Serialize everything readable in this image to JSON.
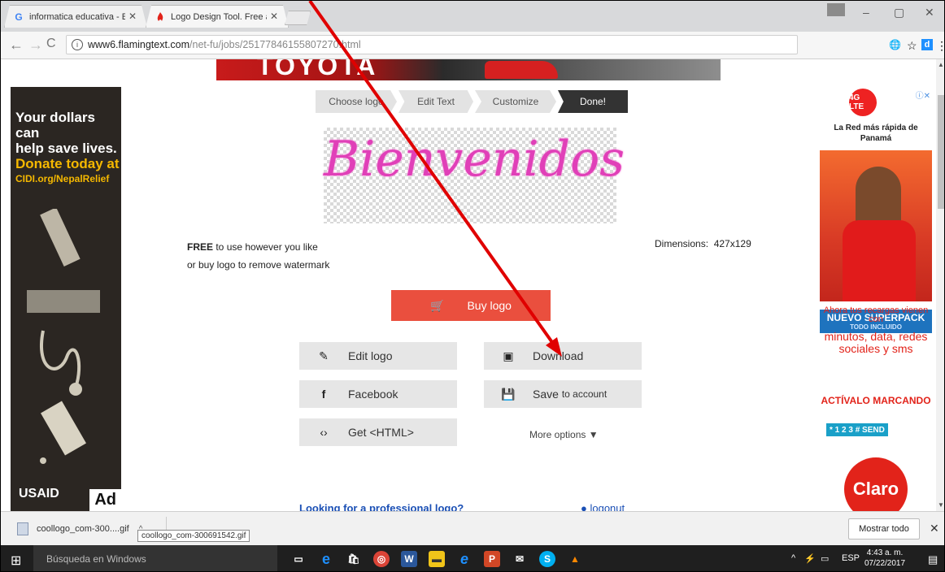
{
  "browser": {
    "tabs": [
      {
        "title": "informatica educativa - E",
        "favicon": "G",
        "favicon_color": "#4285f4"
      },
      {
        "title": "Logo Design Tool. Free a",
        "favicon": "flame-icon",
        "favicon_color": "#e2231a"
      }
    ],
    "url_host": "www6.flamingtext.com",
    "url_path": "/net-fu/jobs/25177846155807270.html",
    "window_controls": {
      "minimize": "–",
      "restore": "▢",
      "close": "✕"
    }
  },
  "page": {
    "banner_text": "TOYOTA",
    "steps": [
      "Choose logo",
      "Edit Text",
      "Customize",
      "Done!"
    ],
    "logo_text": "Bienvenidos",
    "free_bold": "FREE",
    "free_rest": " to use however you like",
    "watermark_line": "or buy logo to remove watermark",
    "dimensions_label": "Dimensions:",
    "dimensions_value": "427x129",
    "buy_label": "Buy logo",
    "edit_label": "Edit logo",
    "download_label": "Download",
    "facebook_label": "Facebook",
    "save_label": "Save",
    "save_suffix": "to account",
    "html_label": "Get <HTML>",
    "more_options": "More options ▼",
    "pro_link": "Looking for a professional logo?",
    "logonut": "logonut"
  },
  "left_ad": {
    "line1": "Your dollars can",
    "line2": "help save lives.",
    "line3": "Donate today at",
    "url": "CIDI.org/NepalRelief",
    "usaid": "USAID",
    "badge": "Ad"
  },
  "right_ad": {
    "badge_4g": "4G LTE",
    "head": "La Red más rápida de Panamá",
    "super": "NUEVO SUPERPACK",
    "super_sub": "TODO INCLUIDO",
    "text1": "Ahora tus recargas vienen con",
    "text2": "minutos, data, redes sociales y sms",
    "activalo": "ACTÍVALO MARCANDO",
    "code": "* 1 2 3 # SEND",
    "claro": "Claro"
  },
  "shelf": {
    "file_name": "coollogo_com-300....gif",
    "tooltip": "coollogo_com-300691542.gif",
    "show_all": "Mostrar todo"
  },
  "taskbar": {
    "search": "Búsqueda en Windows",
    "lang": "ESP",
    "time": "4:43 a. m.",
    "date": "07/22/2017"
  },
  "colors": {
    "buy_button": "#ea4f3e",
    "annotation_arrow": "#e00000",
    "logo_pink": "#e040b8"
  }
}
